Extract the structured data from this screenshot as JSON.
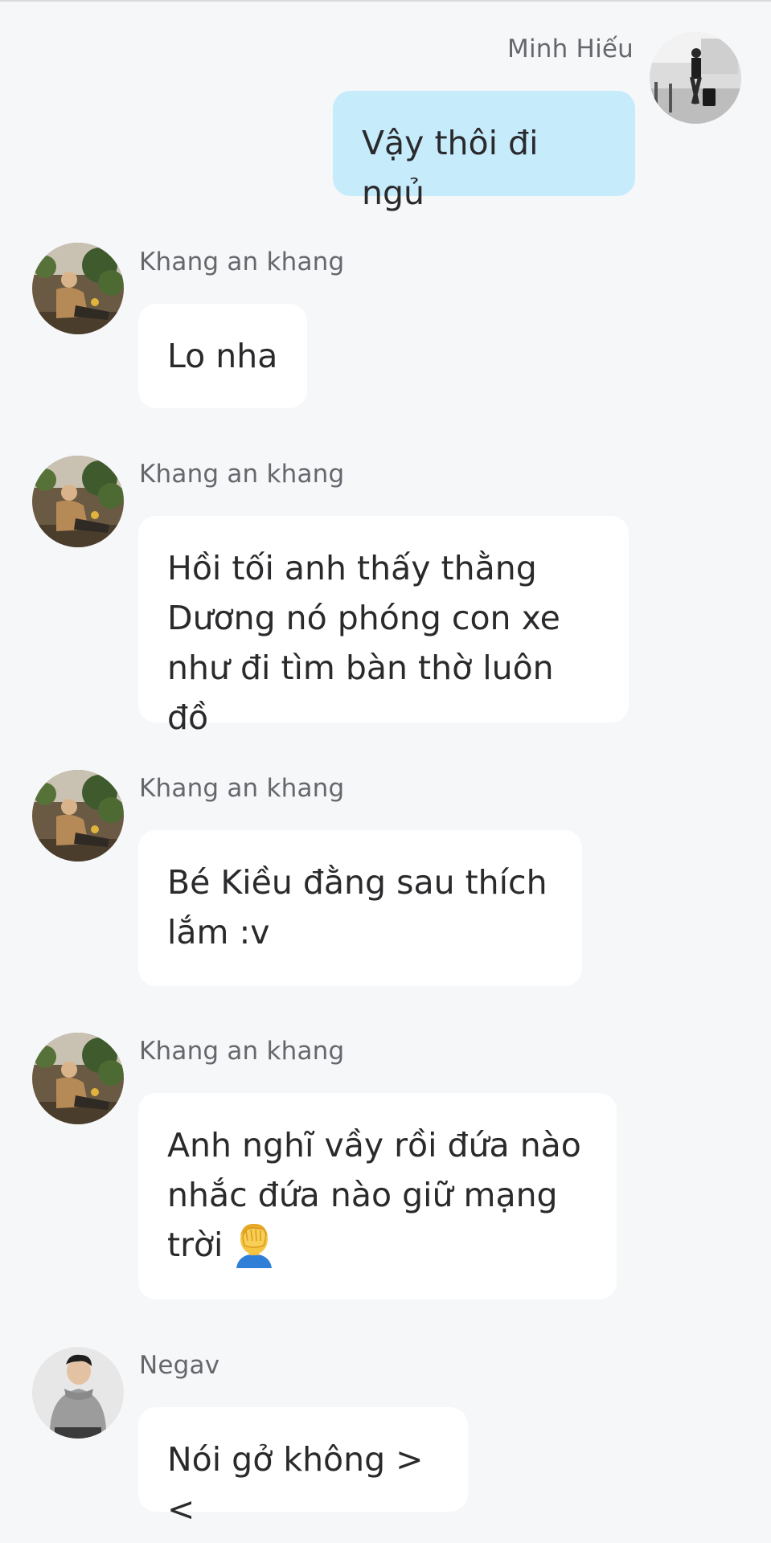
{
  "chat": {
    "messages": [
      {
        "sender": "Minh Hiếu",
        "direction": "outgoing",
        "avatar": "minh-hieu-avatar",
        "text": "Vậy thôi đi ngủ"
      },
      {
        "sender": "Khang an khang",
        "direction": "incoming",
        "avatar": "khang-avatar",
        "text": "Lo nha"
      },
      {
        "sender": "Khang an khang",
        "direction": "incoming",
        "avatar": "khang-avatar",
        "text": "Hồi tối anh thấy thằng\nDương nó phóng con xe\nnhư đi tìm bàn thờ luôn đồ"
      },
      {
        "sender": "Khang an khang",
        "direction": "incoming",
        "avatar": "khang-avatar",
        "text": "Bé Kiều đằng sau thích\nlắm :v"
      },
      {
        "sender": "Khang an khang",
        "direction": "incoming",
        "avatar": "khang-avatar",
        "text": "Anh nghĩ vầy rồi đứa nào\nnhắc đứa nào giữ mạng\ntrời",
        "emoji": "facepalm-emoji"
      },
      {
        "sender": "Negav",
        "direction": "incoming",
        "avatar": "negav-avatar",
        "text": "Nói gở không ><"
      }
    ]
  },
  "colors": {
    "background": "#f6f7f9",
    "incoming_bubble": "#ffffff",
    "outgoing_bubble": "#c6ecfb",
    "sender_name": "#66676d"
  }
}
